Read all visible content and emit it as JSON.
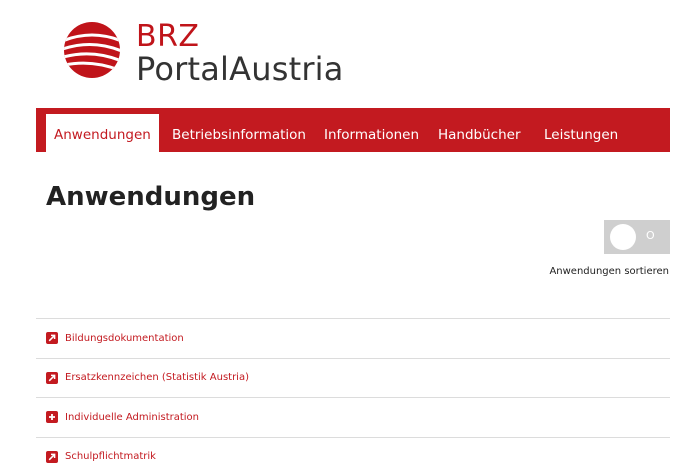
{
  "logo": {
    "line1": "BRZ",
    "line2": "PortalAustria",
    "accent_color": "#c0141a"
  },
  "nav": {
    "items": [
      {
        "label": "Anwendungen",
        "active": true
      },
      {
        "label": "Betriebsinformation",
        "active": false
      },
      {
        "label": "Informationen",
        "active": false
      },
      {
        "label": "Handbücher",
        "active": false
      },
      {
        "label": "Leistungen",
        "active": false
      }
    ],
    "bar_color": "#c31a20"
  },
  "page": {
    "title": "Anwendungen"
  },
  "sort_toggle": {
    "state_text": "O",
    "label": "Anwendungen sortieren",
    "on": false
  },
  "applications": [
    {
      "label": "Bildungsdokumentation",
      "icon": "external-link-icon"
    },
    {
      "label": "Ersatzkennzeichen (Statistik Austria)",
      "icon": "external-link-icon"
    },
    {
      "label": "Individuelle Administration",
      "icon": "plus-icon"
    },
    {
      "label": "Schulpflichtmatrik",
      "icon": "external-link-icon"
    }
  ]
}
